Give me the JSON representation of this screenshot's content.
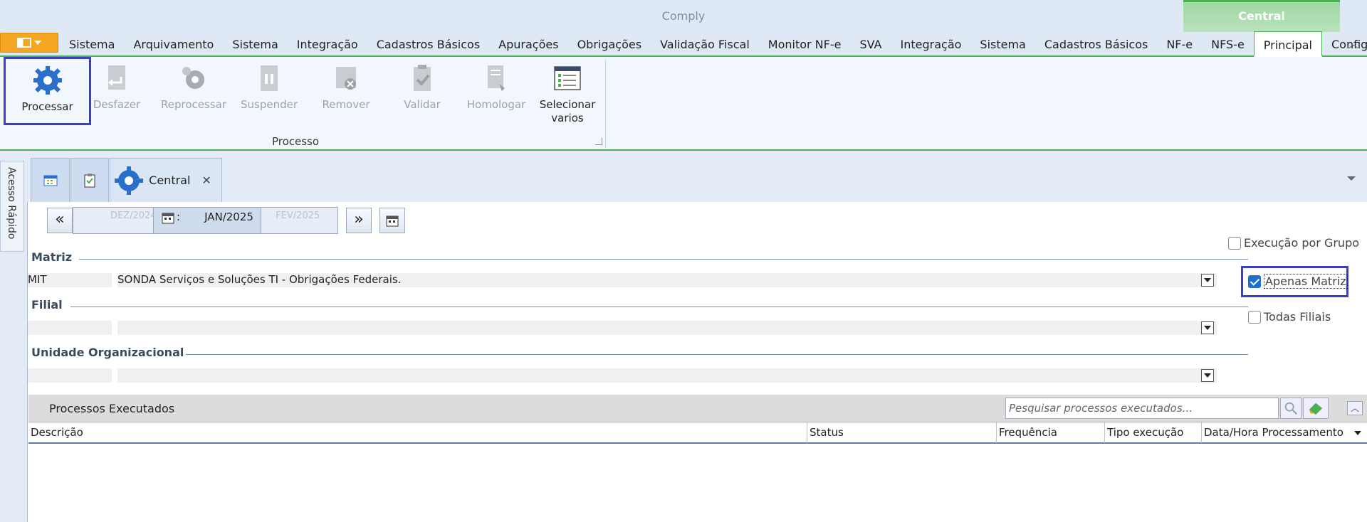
{
  "app": {
    "title": "Comply",
    "context_group": "Central"
  },
  "menu": {
    "tabs": [
      "Sistema",
      "Arquivamento",
      "Sistema",
      "Integração",
      "Cadastros Básicos",
      "Apurações",
      "Obrigações",
      "Validação Fiscal",
      "Monitor NF-e",
      "SVA",
      "Integração",
      "Sistema",
      "Cadastros Básicos",
      "NF-e",
      "NFS-e",
      "Principal",
      "Configurações"
    ],
    "active_tab": "Principal"
  },
  "ribbon": {
    "group_label": "Processo",
    "buttons": [
      {
        "label": "Processar",
        "icon": "gear-icon",
        "enabled": true,
        "selected": true
      },
      {
        "label": "Desfazer",
        "icon": "undo-document-icon",
        "enabled": false
      },
      {
        "label": "Reprocessar",
        "icon": "gears-icon",
        "enabled": false
      },
      {
        "label": "Suspender",
        "icon": "pause-document-icon",
        "enabled": false
      },
      {
        "label": "Remover",
        "icon": "remove-document-icon",
        "enabled": false
      },
      {
        "label": "Validar",
        "icon": "validate-clipboard-icon",
        "enabled": false
      },
      {
        "label": "Homologar",
        "icon": "approve-document-icon",
        "enabled": false
      },
      {
        "label": "Selecionar varios",
        "icon": "checklist-window-icon",
        "enabled": true
      }
    ]
  },
  "side_rail": {
    "label": "Acesso Rápido"
  },
  "doc_tabs": {
    "active_title": "Central"
  },
  "period": {
    "prev": "DEZ/2024",
    "current": "JAN/2025",
    "next": "FEV/2025",
    "sep": ":"
  },
  "sections": {
    "matriz": {
      "label": "Matriz",
      "code": "MIT",
      "description": "SONDA Serviços e Soluções TI - Obrigações Federais."
    },
    "filial": {
      "label": "Filial",
      "code": "",
      "description": ""
    },
    "unidade": {
      "label": "Unidade Organizacional",
      "code": "",
      "description": ""
    }
  },
  "options": {
    "execucao_por_grupo": {
      "label": "Execução por Grupo",
      "checked": false
    },
    "apenas_matriz": {
      "label": "Apenas Matriz",
      "checked": true
    },
    "todas_filiais": {
      "label": "Todas Filiais",
      "checked": false
    }
  },
  "grid": {
    "title": "Processos Executados",
    "search_placeholder": "Pesquisar processos executados...",
    "columns": [
      "Descrição",
      "Status",
      "Frequência",
      "Tipo execução",
      "Data/Hora Processamento"
    ]
  },
  "colors": {
    "accent": "#4caf50",
    "selection": "#3b3fbf",
    "app_button": "#f5a623"
  }
}
